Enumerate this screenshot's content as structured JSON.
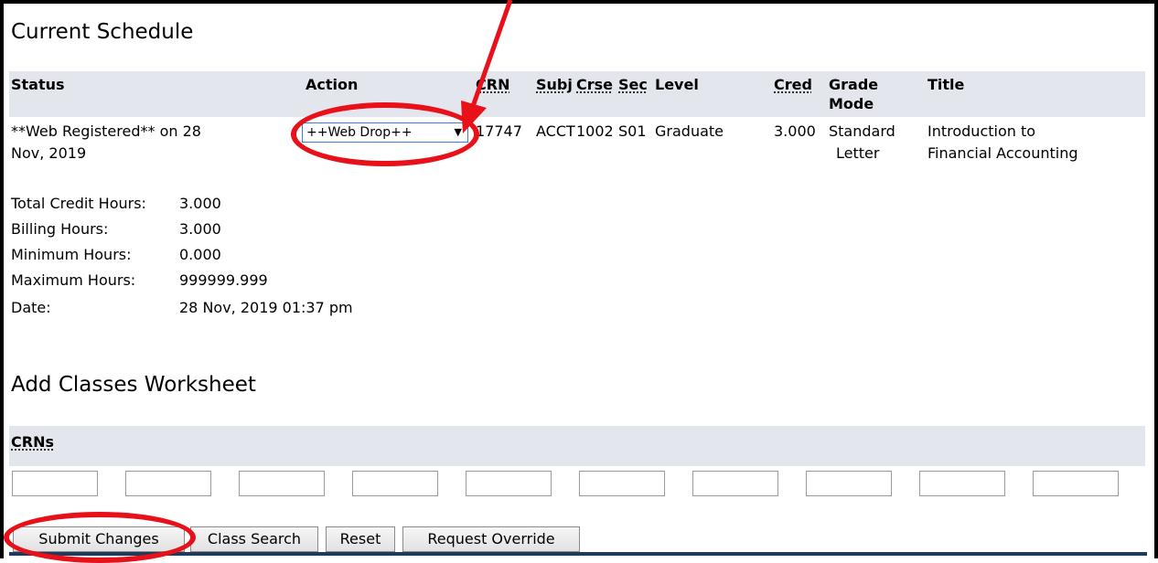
{
  "current_schedule": {
    "heading": "Current Schedule",
    "columns": {
      "status": "Status",
      "action": "Action",
      "crn": "CRN",
      "subj": "Subj",
      "crse": "Crse",
      "sec": "Sec",
      "level": "Level",
      "cred": "Cred",
      "grade_mode_1": "Grade",
      "grade_mode_2": "Mode",
      "title": "Title"
    },
    "row": {
      "status_line1": "**Web Registered** on 28",
      "status_line2": "Nov, 2019",
      "action_selected": "++Web Drop++",
      "crn": "17747",
      "subj": "ACCT",
      "crse": "1002",
      "sec": "S01",
      "level": "Graduate",
      "cred": "3.000",
      "grade_mode_line1": "Standard",
      "grade_mode_line2": "Letter",
      "title_line1": "Introduction to",
      "title_line2": "Financial Accounting"
    },
    "summary": [
      {
        "label": "Total Credit Hours:",
        "value": "3.000"
      },
      {
        "label": "Billing Hours:",
        "value": "3.000"
      },
      {
        "label": "Minimum Hours:",
        "value": "0.000"
      },
      {
        "label": "Maximum Hours:",
        "value": "999999.999"
      },
      {
        "label": "Date:",
        "value": "28 Nov, 2019 01:37 pm"
      }
    ]
  },
  "add_classes": {
    "heading": "Add Classes Worksheet",
    "crns_label": "CRNs",
    "inputs": [
      "",
      "",
      "",
      "",
      "",
      "",
      "",
      "",
      "",
      ""
    ]
  },
  "buttons": {
    "submit": "Submit Changes",
    "class_search": "Class Search",
    "reset": "Reset",
    "request_override": "Request Override"
  },
  "colors": {
    "header_bg": "#e3e6ed",
    "annotation_red": "#e8111a",
    "select_border": "#3d7bd9"
  },
  "icons": {
    "dropdown": "triangle-down"
  }
}
